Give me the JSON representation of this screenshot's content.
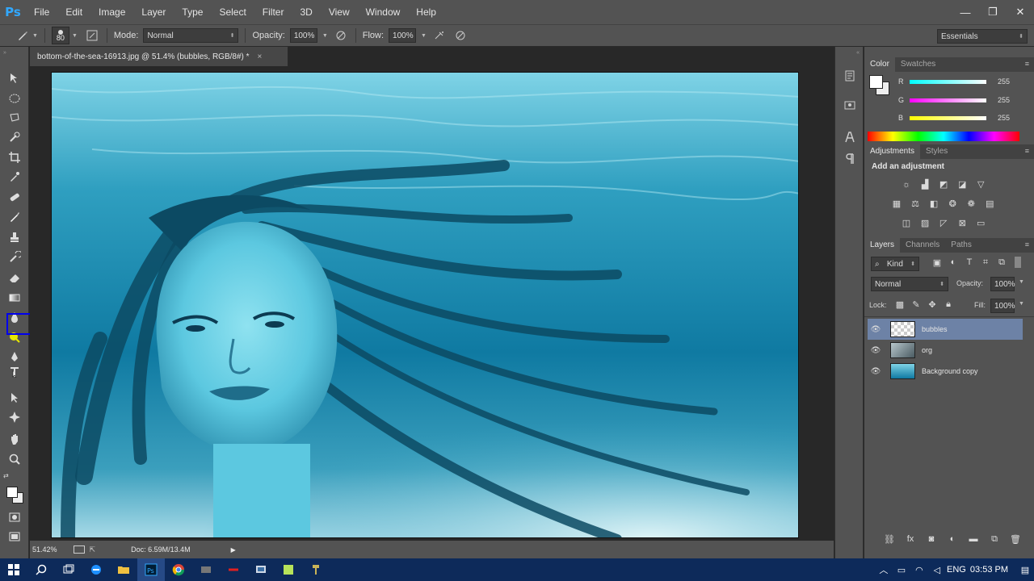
{
  "app": {
    "logo": "Ps"
  },
  "menu": [
    "File",
    "Edit",
    "Image",
    "Layer",
    "Type",
    "Select",
    "Filter",
    "3D",
    "View",
    "Window",
    "Help"
  ],
  "window_controls": {
    "minimize": "—",
    "restore": "❐",
    "close": "✕"
  },
  "options": {
    "brush_size": "80",
    "mode_label": "Mode:",
    "mode_value": "Normal",
    "opacity_label": "Opacity:",
    "opacity_value": "100%",
    "flow_label": "Flow:",
    "flow_value": "100%",
    "workspace": "Essentials"
  },
  "document": {
    "tab_title": "bottom-of-the-sea-16913.jpg @ 51.4% (bubbles, RGB/8#) *",
    "tab_close": "×",
    "zoom": "51.42%",
    "doc_info": "Doc: 6.59M/13.4M"
  },
  "color_panel": {
    "tabs": [
      "Color",
      "Swatches"
    ],
    "channels": [
      {
        "label": "R",
        "value": "255"
      },
      {
        "label": "G",
        "value": "255"
      },
      {
        "label": "B",
        "value": "255"
      }
    ]
  },
  "adjustments_panel": {
    "tabs": [
      "Adjustments",
      "Styles"
    ],
    "heading": "Add an adjustment"
  },
  "layers_panel": {
    "tabs": [
      "Layers",
      "Channels",
      "Paths"
    ],
    "filter_kind": "Kind",
    "blend_mode": "Normal",
    "opacity_label": "Opacity:",
    "opacity_value": "100%",
    "lock_label": "Lock:",
    "fill_label": "Fill:",
    "fill_value": "100%",
    "layers": [
      {
        "name": "bubbles",
        "selected": true
      },
      {
        "name": "org",
        "selected": false
      },
      {
        "name": "Background copy",
        "selected": false
      }
    ]
  },
  "taskbar": {
    "language": "ENG",
    "time": "03:53 PM"
  },
  "colors": {
    "accent_blue": "#31a8ff",
    "selected_layer": "#6d82a6",
    "tool_highlight": "#0000ee"
  }
}
